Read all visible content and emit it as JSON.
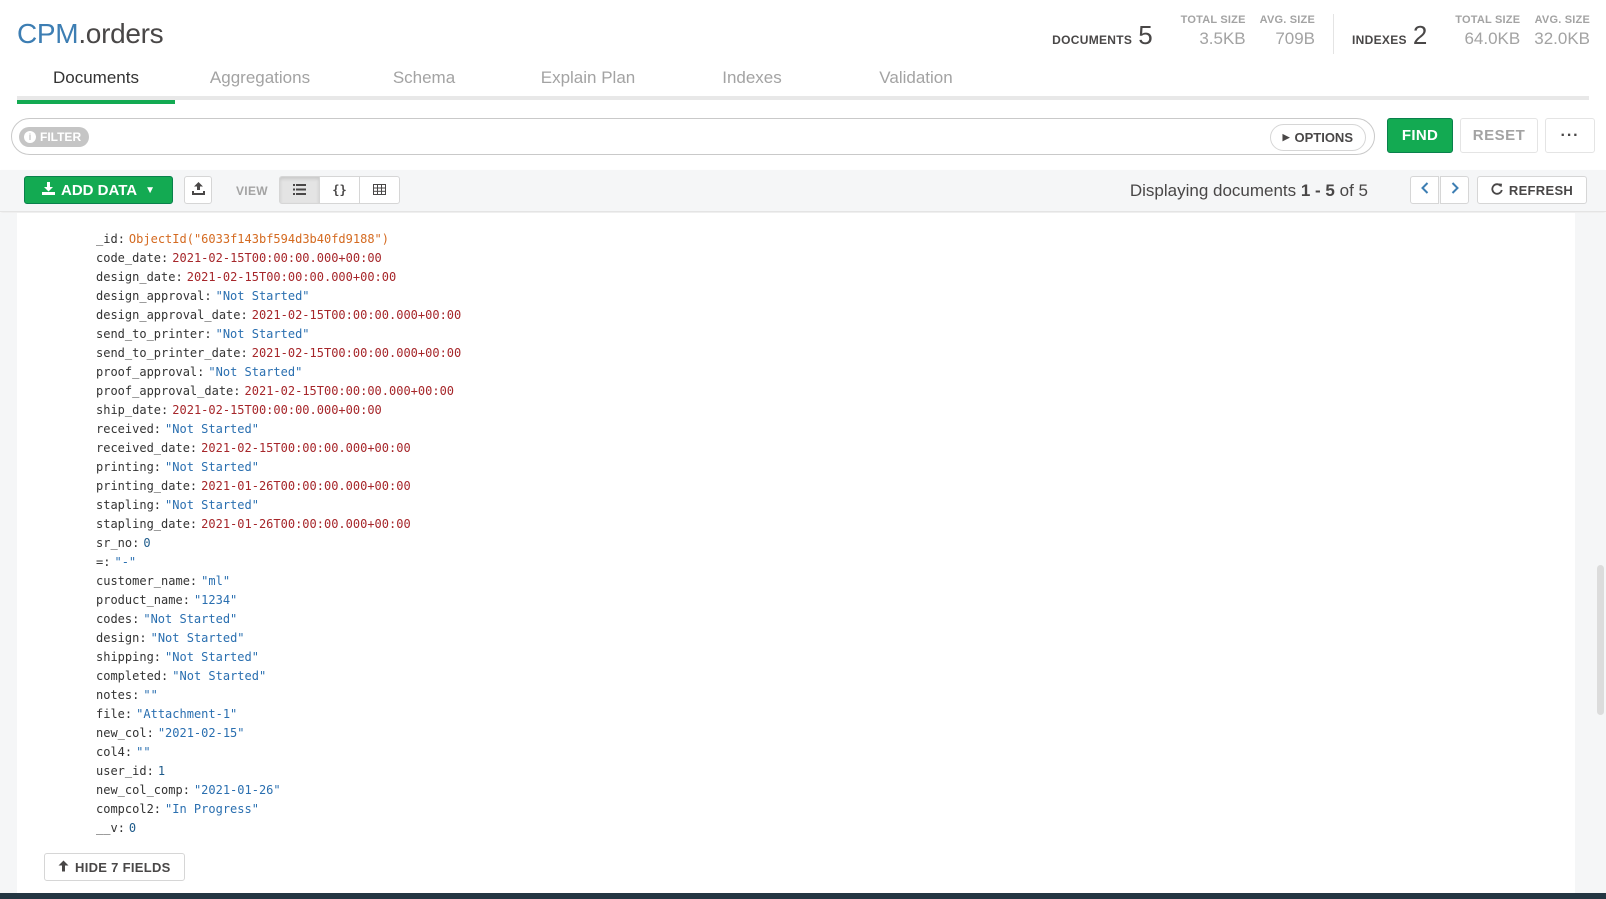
{
  "header": {
    "db_name": "CPM",
    "coll_name": ".orders"
  },
  "stats": {
    "documents_label": "DOCUMENTS",
    "documents_count": "5",
    "doc_total_size_label": "TOTAL SIZE",
    "doc_total_size": "3.5KB",
    "doc_avg_size_label": "AVG. SIZE",
    "doc_avg_size": "709B",
    "indexes_label": "INDEXES",
    "indexes_count": "2",
    "idx_total_size_label": "TOTAL SIZE",
    "idx_total_size": "64.0KB",
    "idx_avg_size_label": "AVG. SIZE",
    "idx_avg_size": "32.0KB"
  },
  "tabs": [
    {
      "label": "Documents",
      "active": true
    },
    {
      "label": "Aggregations"
    },
    {
      "label": "Schema"
    },
    {
      "label": "Explain Plan"
    },
    {
      "label": "Indexes"
    },
    {
      "label": "Validation"
    }
  ],
  "querybar": {
    "filter_label": "FILTER",
    "filter_value": "",
    "options_label": "OPTIONS",
    "find_label": "FIND",
    "reset_label": "RESET",
    "more_label": "···"
  },
  "controls": {
    "add_data_label": "ADD DATA",
    "view_label": "VIEW",
    "paging_prefix": "Displaying documents ",
    "paging_range": "1 - 5",
    "paging_of": " of ",
    "paging_total": "5",
    "refresh_label": "REFRESH"
  },
  "document": {
    "fields": [
      {
        "key": "_id",
        "value": "ObjectId(\"6033f143bf594d3b40fd9188\")",
        "type": "oid"
      },
      {
        "key": "code_date",
        "value": "2021-02-15T00:00:00.000+00:00",
        "type": "date"
      },
      {
        "key": "design_date",
        "value": "2021-02-15T00:00:00.000+00:00",
        "type": "date"
      },
      {
        "key": "design_approval",
        "value": "\"Not Started\"",
        "type": "str"
      },
      {
        "key": "design_approval_date",
        "value": "2021-02-15T00:00:00.000+00:00",
        "type": "date"
      },
      {
        "key": "send_to_printer",
        "value": "\"Not Started\"",
        "type": "str"
      },
      {
        "key": "send_to_printer_date",
        "value": "2021-02-15T00:00:00.000+00:00",
        "type": "date"
      },
      {
        "key": "proof_approval",
        "value": "\"Not Started\"",
        "type": "str"
      },
      {
        "key": "proof_approval_date",
        "value": "2021-02-15T00:00:00.000+00:00",
        "type": "date"
      },
      {
        "key": "ship_date",
        "value": "2021-02-15T00:00:00.000+00:00",
        "type": "date"
      },
      {
        "key": "received",
        "value": "\"Not Started\"",
        "type": "str"
      },
      {
        "key": "received_date",
        "value": "2021-02-15T00:00:00.000+00:00",
        "type": "date"
      },
      {
        "key": "printing",
        "value": "\"Not Started\"",
        "type": "str"
      },
      {
        "key": "printing_date",
        "value": "2021-01-26T00:00:00.000+00:00",
        "type": "date"
      },
      {
        "key": "stapling",
        "value": "\"Not Started\"",
        "type": "str"
      },
      {
        "key": "stapling_date",
        "value": "2021-01-26T00:00:00.000+00:00",
        "type": "date"
      },
      {
        "key": "sr_no",
        "value": "0",
        "type": "num"
      },
      {
        "key": "=",
        "value": "\"-\"",
        "type": "str"
      },
      {
        "key": "customer_name",
        "value": "\"ml\"",
        "type": "str"
      },
      {
        "key": "product_name",
        "value": "\"1234\"",
        "type": "str"
      },
      {
        "key": "codes",
        "value": "\"Not Started\"",
        "type": "str"
      },
      {
        "key": "design",
        "value": "\"Not Started\"",
        "type": "str"
      },
      {
        "key": "shipping",
        "value": "\"Not Started\"",
        "type": "str"
      },
      {
        "key": "completed",
        "value": "\"Not Started\"",
        "type": "str"
      },
      {
        "key": "notes",
        "value": "\"\"",
        "type": "str"
      },
      {
        "key": "file",
        "value": "\"Attachment-1\"",
        "type": "str"
      },
      {
        "key": "new_col",
        "value": "\"2021-02-15\"",
        "type": "str"
      },
      {
        "key": "col4",
        "value": "\"\"",
        "type": "str"
      },
      {
        "key": "user_id",
        "value": "1",
        "type": "num"
      },
      {
        "key": "new_col_comp",
        "value": "\"2021-01-26\"",
        "type": "str"
      },
      {
        "key": "compcol2",
        "value": "\"In Progress\"",
        "type": "str"
      },
      {
        "key": "__v",
        "value": "0",
        "type": "num"
      }
    ],
    "hide_fields_label": "HIDE 7 FIELDS"
  },
  "colors": {
    "accent_green": "#13aa52",
    "db_blue": "#3d7eb3",
    "oid_orange": "#d46a20",
    "date_red": "#a6262a",
    "string_blue": "#2a6fb0"
  },
  "icons": {
    "add_data": "download-icon",
    "export": "export-icon",
    "view_list": "list-view-icon",
    "view_json": "json-view-icon",
    "view_table": "table-view-icon",
    "prev": "chevron-left-icon",
    "next": "chevron-right-icon",
    "refresh": "refresh-icon",
    "hide": "arrow-up-icon"
  }
}
